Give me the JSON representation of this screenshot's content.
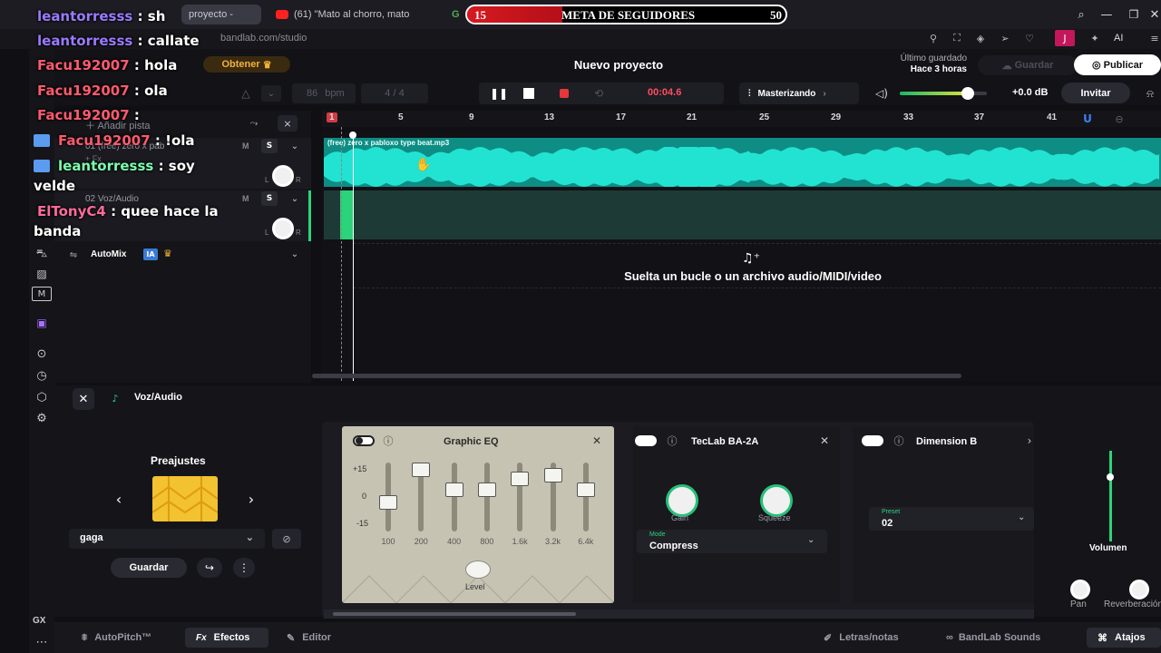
{
  "browser": {
    "tabs": [
      "proyecto -",
      "(61) \"Mato al chorro, mato",
      "G"
    ],
    "url": "bandlab.com/studio",
    "ai_label": "AI",
    "avatar_letter": "J"
  },
  "overlay": {
    "goal": {
      "current": "15",
      "title": "META DE SEGUIDORES",
      "target": "50",
      "progress": 0.3
    },
    "chat": [
      {
        "user": "leantorresss",
        "text": " : sh",
        "color": "u1"
      },
      {
        "user": "leantorresss",
        "text": " : callate",
        "color": "u1"
      },
      {
        "user": "Facu192007",
        "text": " : hola",
        "color": "u2"
      },
      {
        "user": "Facu192007",
        "text": " : ola",
        "color": "u2"
      },
      {
        "user": "Facu192007",
        "text": " :",
        "color": "u2"
      },
      {
        "user": "Facu192007",
        "text": " : !ola",
        "color": "u2"
      },
      {
        "user": "leantorresss",
        "text": " : soy",
        "color": "u3",
        "cont": "velde"
      },
      {
        "user": "ElTonyC4",
        "text": " : quee hace la",
        "color": "u4",
        "cont": "banda"
      }
    ]
  },
  "header": {
    "upgrade_label": "Obtener",
    "project_title": "Nuevo proyecto",
    "saved_label": "Último guardado",
    "saved_time": "Hace 3 horas",
    "save_button": "Guardar",
    "publish_button": "Publicar"
  },
  "toolbar": {
    "bpm_value": "86",
    "bpm_label": "bpm",
    "time_signature": "4 / 4",
    "time": "00:04.6",
    "mastering_label": "Masterizando",
    "volume_db": "+0.0 dB",
    "volume_level": 0.78,
    "invite_button": "Invitar"
  },
  "ruler": {
    "marks": [
      "1",
      "5",
      "9",
      "13",
      "17",
      "21",
      "25",
      "29",
      "33",
      "37",
      "41"
    ]
  },
  "tracks": {
    "add_track": "Añadir pista",
    "track1_name": "01 (free) zero x pab",
    "track1_fx": "+ Fx",
    "track2_name": "02 Voz/Audio",
    "automix": "AutoMix",
    "ia_badge": "IA",
    "clip_label": "(free) zero x pabloxo type beat.mp3",
    "m_label": "M",
    "s_label": "S",
    "l_label": "L",
    "r_label": "R",
    "drop_hint": "Suelta un bucle o un archivo audio/MIDI/video"
  },
  "panel": {
    "track_name": "Voz/Audio",
    "presets_title": "Preajustes",
    "preset_name": "gaga",
    "save_preset": "Guardar",
    "eq": {
      "title": "Graphic EQ",
      "scale": [
        "+15",
        "0",
        "-15"
      ],
      "bands": [
        "100",
        "200",
        "400",
        "800",
        "1.6k",
        "3.2k",
        "6.4k"
      ],
      "level_label": "Level"
    },
    "comp": {
      "title": "TecLab BA-2A",
      "gain_label": "Gain",
      "squeeze_label": "Squeeze",
      "mode_label": "Mode",
      "mode_value": "Compress"
    },
    "dimension": {
      "title": "Dimension B",
      "preset_label": "Preset",
      "preset_value": "02"
    },
    "volume_label": "Volumen",
    "pan_label": "Pan",
    "reverb_label": "Reverberación"
  },
  "footer": {
    "autopitch": "AutoPitch™",
    "effects": "Efectos",
    "fx_prefix": "Fx",
    "editor": "Editor",
    "lyrics": "Letras/notas",
    "sounds": "BandLab Sounds",
    "shortcuts": "Atajos"
  },
  "sidebar": {
    "gx_label": "GX"
  }
}
